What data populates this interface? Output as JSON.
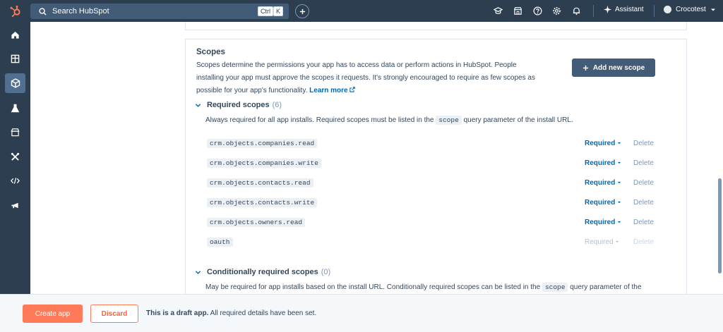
{
  "topbar": {
    "search_placeholder": "Search HubSpot",
    "kbd_ctrl": "Ctrl",
    "kbd_k": "K",
    "assistant_label": "Assistant",
    "account_name": "Crocotest"
  },
  "rail": {
    "icons": [
      "home-icon",
      "dashboard-icon",
      "cube-icon",
      "flask-icon",
      "store-icon",
      "tools-icon",
      "code-icon",
      "megaphone-icon"
    ],
    "active_index": 2
  },
  "scopes": {
    "title": "Scopes",
    "description": "Scopes determine the permissions your app has to access data or perform actions in HubSpot. People installing your app must approve the scopes it requests. It's strongly encouraged to require as few scopes as possible for your app's functionality.",
    "learn_more": "Learn more",
    "add_button": "Add new scope"
  },
  "required_section": {
    "title": "Required scopes",
    "count": "(6)",
    "desc_before": "Always required for all app installs. Required scopes must be listed in the",
    "desc_code": "scope",
    "desc_after": "query parameter of the install URL.",
    "rows": [
      {
        "name": "crm.objects.companies.read",
        "status": "Required",
        "action": "Delete"
      },
      {
        "name": "crm.objects.companies.write",
        "status": "Required",
        "action": "Delete"
      },
      {
        "name": "crm.objects.contacts.read",
        "status": "Required",
        "action": "Delete"
      },
      {
        "name": "crm.objects.contacts.write",
        "status": "Required",
        "action": "Delete"
      },
      {
        "name": "crm.objects.owners.read",
        "status": "Required",
        "action": "Delete"
      },
      {
        "name": "oauth",
        "status": "Required",
        "action": "Delete"
      }
    ]
  },
  "conditional_section": {
    "title": "Conditionally required scopes",
    "count": "(0)",
    "desc_before": "May be required for app installs based on the install URL. Conditionally required scopes can be listed in the",
    "desc_code": "scope",
    "desc_after": "query parameter of the"
  },
  "footer": {
    "create_label": "Create app",
    "discard_label": "Discard",
    "draft_bold": "This is a draft app.",
    "draft_rest": " All required details have been set."
  },
  "colors": {
    "nav_bg": "#2d3e50",
    "link": "#0068b1",
    "primary_btn": "#ff7a59",
    "secondary_btn": "#425b76"
  }
}
